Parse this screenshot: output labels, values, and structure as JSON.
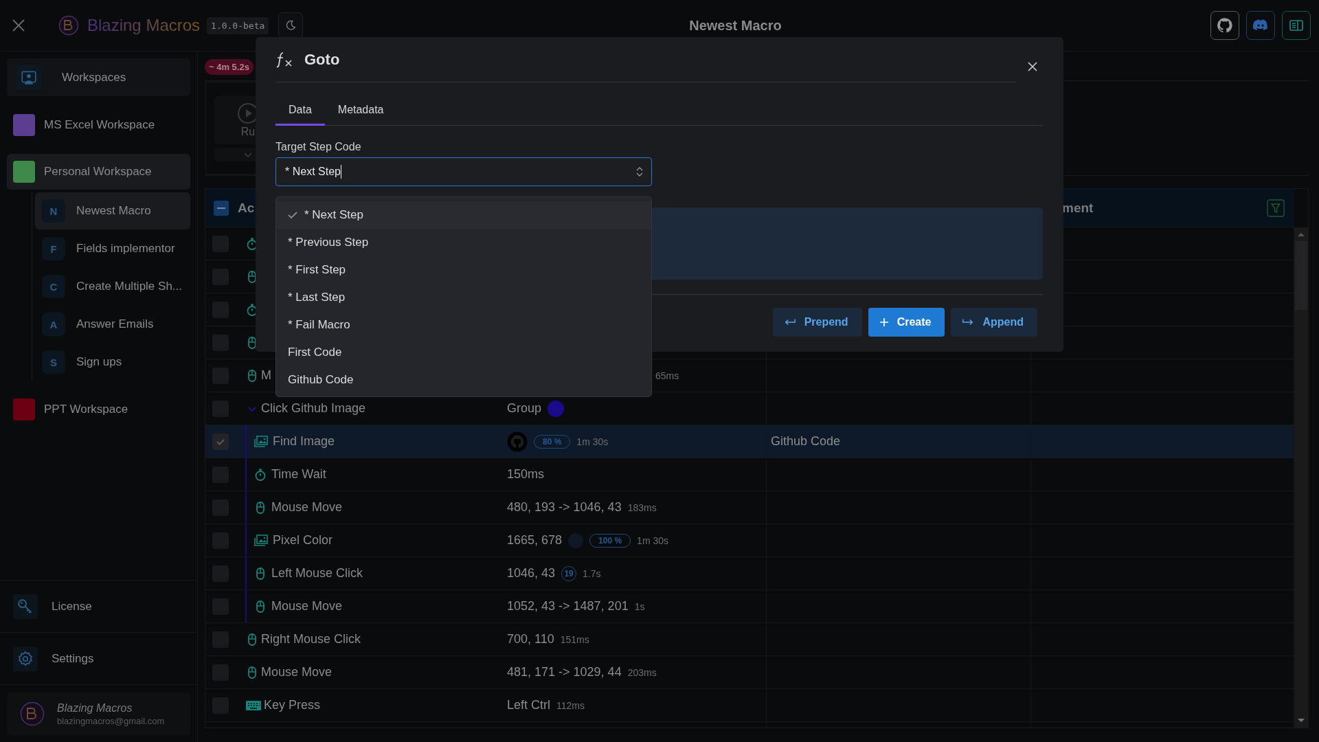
{
  "topbar": {
    "app_name": "Blazing Macros",
    "version": "1.0.0-beta",
    "title": "Newest Macro"
  },
  "sidebar": {
    "header": "Workspaces",
    "workspaces": [
      {
        "name": "MS Excel Workspace",
        "color": "#5b3e8f",
        "selected": false
      },
      {
        "name": "Personal Workspace",
        "color": "#3f8a4a",
        "selected": true,
        "macros": [
          {
            "initial": "N",
            "name": "Newest Macro",
            "selected": true
          },
          {
            "initial": "F",
            "name": "Fields implementor",
            "selected": false
          },
          {
            "initial": "C",
            "name": "Create Multiple Sh...",
            "selected": false
          },
          {
            "initial": "A",
            "name": "Answer Emails",
            "selected": false
          },
          {
            "initial": "S",
            "name": "Sign ups",
            "selected": false
          }
        ]
      },
      {
        "name": "PPT Workspace",
        "color": "#6e0014",
        "selected": false
      }
    ],
    "footer": [
      {
        "kind": "license",
        "label": "License"
      },
      {
        "kind": "settings",
        "label": "Settings"
      }
    ],
    "user": {
      "name": "Blazing Macros",
      "email": "blazingmacros@gmail.com"
    }
  },
  "run": {
    "estimate": "~ 4m 5.2s",
    "label": "Ru"
  },
  "table": {
    "columns": [
      "Ac",
      "ment"
    ],
    "select_all_partial": true,
    "rows": [
      {
        "kind": "wait",
        "selected": false
      },
      {
        "kind": "mouse",
        "selected": false
      },
      {
        "kind": "wait",
        "selected": false
      },
      {
        "kind": "mouse",
        "selected": false
      },
      {
        "kind": "mouse",
        "name": "M",
        "duration": "65ms",
        "selected": false
      },
      {
        "kind": "group",
        "name": "Click Github Image",
        "value": "Group",
        "color": "#1a0a8c",
        "expanded": true,
        "selected": false,
        "children": [
          {
            "kind": "image",
            "name": "Find Image",
            "preview": true,
            "badge": "80 %",
            "duration": "1m 30s",
            "target": "Github Code",
            "selected": true
          },
          {
            "kind": "wait",
            "name": "Time Wait",
            "value": "150ms",
            "selected": false
          },
          {
            "kind": "mouse",
            "name": "Mouse Move",
            "value": "480, 193 -> 1046, 43",
            "duration": "183ms",
            "selected": false
          },
          {
            "kind": "image",
            "name": "Pixel Color",
            "value": "1665, 678",
            "color": "#0f1826",
            "badge": "100 %",
            "duration": "1m 30s",
            "selected": false
          },
          {
            "kind": "mouse",
            "name": "Left Mouse Click",
            "value": "1046, 43",
            "count": "19",
            "duration": "1.7s",
            "selected": false
          },
          {
            "kind": "mouse",
            "name": "Mouse Move",
            "value": "1052, 43 -> 1487, 201",
            "duration": "1s",
            "selected": false
          }
        ]
      },
      {
        "kind": "mouse",
        "name": "Right Mouse Click",
        "value": "700, 110",
        "duration": "151ms",
        "selected": false
      },
      {
        "kind": "mouse",
        "name": "Mouse Move",
        "value": "481, 171 -> 1029, 44",
        "duration": "203ms",
        "selected": false
      },
      {
        "kind": "key",
        "name": "Key Press",
        "value": "Left Ctrl",
        "duration": "112ms",
        "selected": false
      }
    ]
  },
  "modal": {
    "title": "Goto",
    "tabs": [
      {
        "label": "Data",
        "selected": true
      },
      {
        "label": "Metadata",
        "selected": false
      }
    ],
    "field": {
      "label": "Target Step Code",
      "value": "* Next Step"
    },
    "options": [
      {
        "label": "* Next Step",
        "selected": true
      },
      {
        "label": "* Previous Step",
        "selected": false
      },
      {
        "label": "* First Step",
        "selected": false
      },
      {
        "label": "* Last Step",
        "selected": false
      },
      {
        "label": "* Fail Macro",
        "selected": false
      },
      {
        "label": "First Code",
        "selected": false
      },
      {
        "label": "Github Code",
        "selected": false
      }
    ],
    "buttons": [
      {
        "kind": "prepend",
        "label": "Prepend"
      },
      {
        "kind": "create",
        "label": "Create"
      },
      {
        "kind": "append",
        "label": "Append"
      }
    ]
  }
}
